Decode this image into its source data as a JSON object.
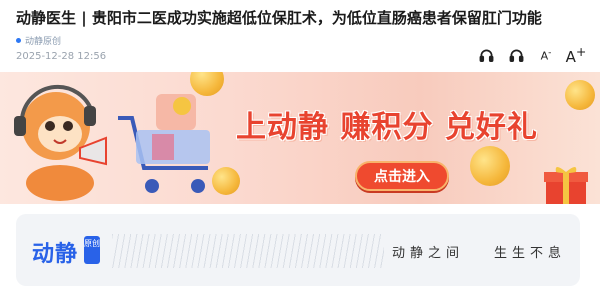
{
  "article": {
    "title": "动静医生 | 贵阳市二医成功实施超低位保肛术，为低位直肠癌患者保留肛门功能",
    "source": "动静原创",
    "datetime": "2025-12-28 12:56"
  },
  "toolbar": {
    "icons": [
      "headphones-icon",
      "headphones-icon",
      "font-decrease-icon",
      "font-increase-icon"
    ],
    "font_small_label": "A",
    "font_small_sup": "-",
    "font_large_label": "A",
    "font_large_sup": "+"
  },
  "banner": {
    "headline": "上动静 赚积分 兑好礼",
    "button_label": "点击进入",
    "colors": {
      "accent": "#e8432f",
      "button": "#ef4a2f",
      "background": "#fbd9cf"
    }
  },
  "brand_card": {
    "logo": "动静",
    "logo_tag": "原创",
    "slogan_left": "动静之间",
    "slogan_right": "生生不息",
    "colors": {
      "brand": "#2962e8",
      "background": "#f2f4f7"
    }
  }
}
